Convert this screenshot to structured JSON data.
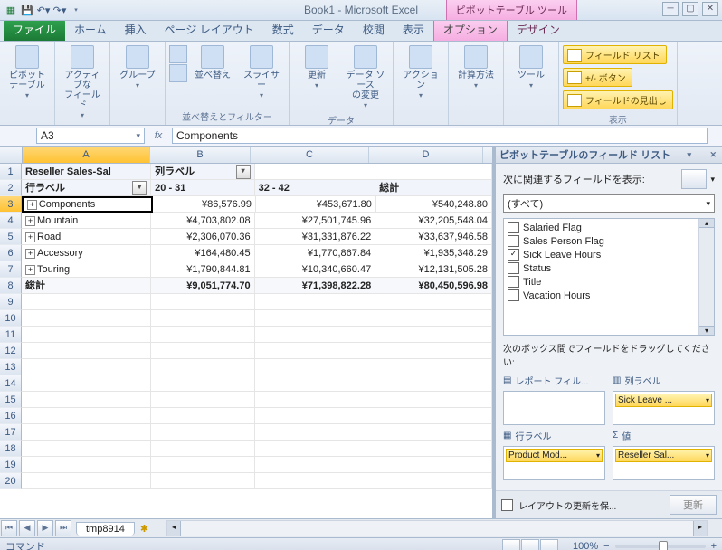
{
  "title": "Book1 - Microsoft Excel",
  "context_title": "ピボットテーブル ツール",
  "tabs": {
    "file": "ファイル",
    "home": "ホーム",
    "insert": "挿入",
    "layout": "ページ レイアウト",
    "formulas": "数式",
    "data": "データ",
    "review": "校閲",
    "view": "表示",
    "options": "オプション",
    "design": "デザイン"
  },
  "ribbon": {
    "pivot": "ピボットテーブル",
    "active": "アクティブな\nフィールド",
    "group": "グループ",
    "sort": "並べ替え",
    "slicer": "スライサー",
    "refresh": "更新",
    "datasource": "データ ソース\nの変更",
    "actions": "アクション",
    "calc": "計算方法",
    "tools": "ツール",
    "g_sort": "並べ替えとフィルター",
    "g_data": "データ",
    "g_show": "表示",
    "fieldlist": "フィールド リスト",
    "pmButtons": "+/- ボタン",
    "fieldheaders": "フィールドの見出し"
  },
  "namebox": "A3",
  "formula": "Components",
  "cols": [
    "A",
    "B",
    "C",
    "D"
  ],
  "sheet": {
    "r1": {
      "a": "Reseller Sales-Sal",
      "b": "列ラベル"
    },
    "r2": {
      "a": "行ラベル",
      "b": "20 - 31",
      "c": "32 - 42",
      "d": "総計"
    },
    "rows": [
      {
        "a": "Components",
        "b": "¥86,576.99",
        "c": "¥453,671.80",
        "d": "¥540,248.80"
      },
      {
        "a": "Mountain",
        "b": "¥4,703,802.08",
        "c": "¥27,501,745.96",
        "d": "¥32,205,548.04"
      },
      {
        "a": "Road",
        "b": "¥2,306,070.36",
        "c": "¥31,331,876.22",
        "d": "¥33,637,946.58"
      },
      {
        "a": "Accessory",
        "b": "¥164,480.45",
        "c": "¥1,770,867.84",
        "d": "¥1,935,348.29"
      },
      {
        "a": "Touring",
        "b": "¥1,790,844.81",
        "c": "¥10,340,660.47",
        "d": "¥12,131,505.28"
      }
    ],
    "total": {
      "a": "総計",
      "b": "¥9,051,774.70",
      "c": "¥71,398,822.28",
      "d": "¥80,450,596.98"
    }
  },
  "pane": {
    "title": "ピボットテーブルのフィールド リスト",
    "choose": "次に関連するフィールドを表示:",
    "all": "(すべて)",
    "fields": [
      {
        "label": "Salaried Flag",
        "checked": false
      },
      {
        "label": "Sales Person Flag",
        "checked": false
      },
      {
        "label": "Sick Leave Hours",
        "checked": true
      },
      {
        "label": "Status",
        "checked": false
      },
      {
        "label": "Title",
        "checked": false
      },
      {
        "label": "Vacation Hours",
        "checked": false
      }
    ],
    "drag": "次のボックス間でフィールドをドラッグしてください:",
    "z_filter": "レポート フィル...",
    "z_cols": "列ラベル",
    "z_rows": "行ラベル",
    "z_vals": "値",
    "item_cols": "Sick Leave ...",
    "item_rows": "Product Mod...",
    "item_vals": "Reseller Sal...",
    "defer": "レイアウトの更新を保...",
    "update": "更新"
  },
  "sheet_tab": "tmp8914",
  "status": "コマンド",
  "zoom": "100%"
}
